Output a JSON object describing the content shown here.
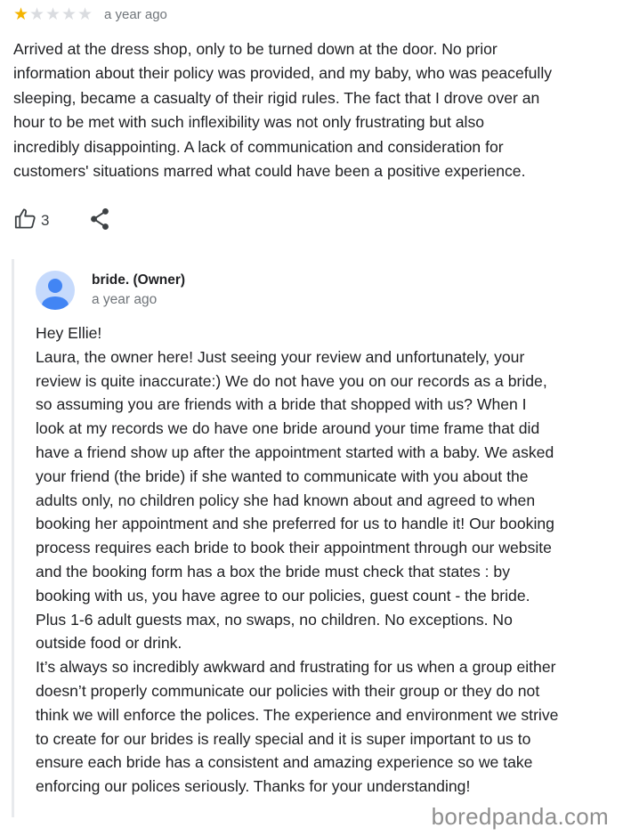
{
  "review": {
    "rating": 1,
    "max_rating": 5,
    "time": "a year ago",
    "text": "Arrived at the dress shop, only to be turned down at the door. No prior\ninformation about their policy was provided, and my baby, who was peacefully\nsleeping, became a casualty of their rigid rules. The fact that I drove over an\nhour to be met with such inflexibility was not only frustrating but also\nincredibly disappointing. A lack of communication and consideration for\ncustomers' situations marred what could have been a positive experience.",
    "like_count": "3",
    "like_icon": "thumbs-up-icon",
    "share_icon": "share-icon"
  },
  "reply": {
    "owner_name": "bride. (Owner)",
    "time": "a year ago",
    "avatar_icon": "person-avatar-icon",
    "text": "Hey Ellie!\nLaura, the owner here! Just seeing your review and unfortunately, your\nreview is quite inaccurate:) We do not have you on our records as a bride,\nso assuming you are friends with a bride that shopped with us? When I\nlook at my records we do have one bride around your time frame that did\nhave a friend show up after the appointment started with a baby. We asked\nyour friend (the bride) if she wanted to communicate with you about the\nadults only, no children policy she had known about and agreed to when\nbooking her appointment and she preferred for us to handle it! Our booking\nprocess requires each bride to book their appointment through our website\nand the booking form has a box the bride must check that states : by\nbooking with us, you have agree to our policies, guest count - the bride.\nPlus 1-6 adult guests max, no swaps, no children. No exceptions. No\noutside food or drink.\nIt’s always so incredibly awkward and frustrating for us when a group either\ndoesn’t properly communicate our policies with their group or they do not\nthink we will enforce the polices. The experience and environment we strive\nto create for our brides is really special and it is super important to us to\nensure each bride has a consistent and amazing experience so we take\nenforcing our polices seriously. Thanks for your understanding!"
  },
  "colors": {
    "star_filled": "#f4b400",
    "star_empty": "#dadce0",
    "avatar_bg": "#c6dafc",
    "avatar_fg": "#4285f4"
  },
  "watermark": "boredpanda.com"
}
